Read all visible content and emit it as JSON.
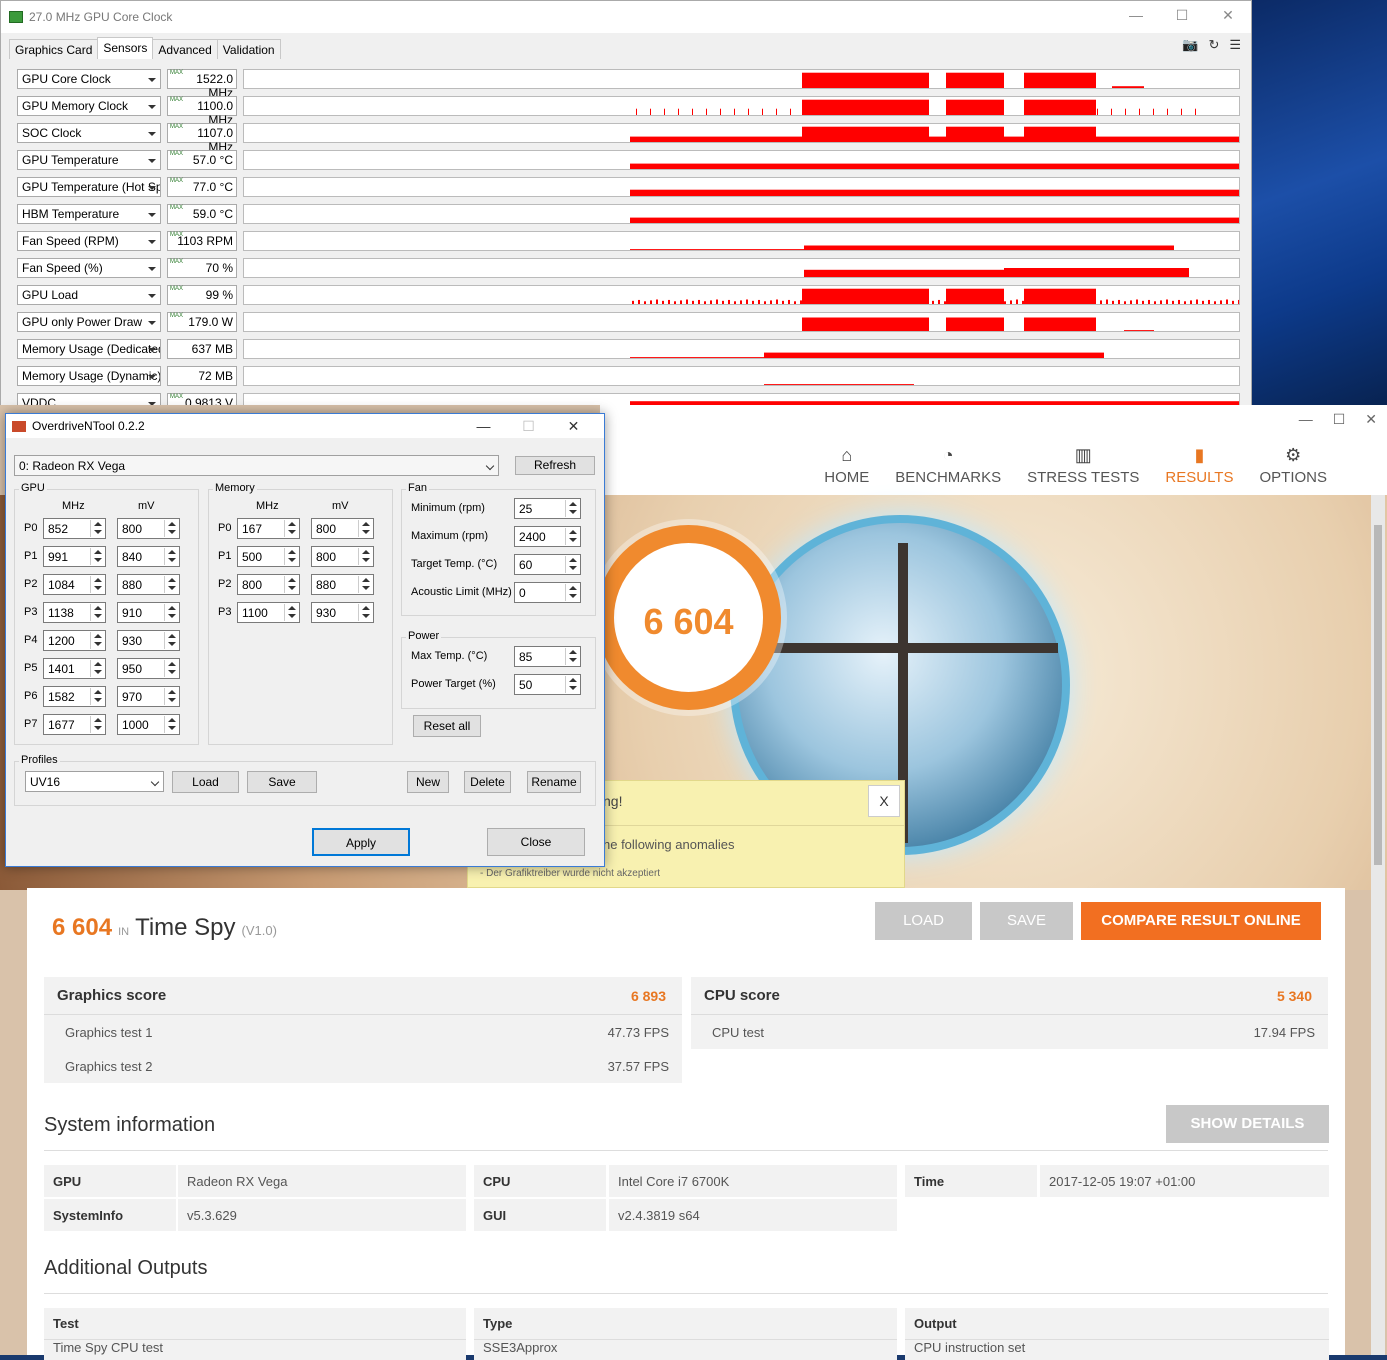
{
  "gpuz": {
    "title": "27.0 MHz GPU Core Clock",
    "tabs": [
      "Graphics Card",
      "Sensors",
      "Advanced",
      "Validation"
    ],
    "max_label": "MAX",
    "sensors": [
      {
        "name": "GPU Core Clock",
        "value": "1522.0 MHz",
        "max": true
      },
      {
        "name": "GPU Memory Clock",
        "value": "1100.0 MHz",
        "max": true
      },
      {
        "name": "SOC Clock",
        "value": "1107.0 MHz",
        "max": true
      },
      {
        "name": "GPU Temperature",
        "value": "57.0 °C",
        "max": true
      },
      {
        "name": "GPU Temperature (Hot Spot)",
        "value": "77.0 °C",
        "max": true
      },
      {
        "name": "HBM Temperature",
        "value": "59.0 °C",
        "max": true
      },
      {
        "name": "Fan Speed (RPM)",
        "value": "1103 RPM",
        "max": true
      },
      {
        "name": "Fan Speed (%)",
        "value": "70 %",
        "max": true
      },
      {
        "name": "GPU Load",
        "value": "99 %",
        "max": true
      },
      {
        "name": "GPU only Power Draw",
        "value": "179.0 W",
        "max": true
      },
      {
        "name": "Memory Usage (Dedicated)",
        "value": "637 MB",
        "max": false
      },
      {
        "name": "Memory Usage (Dynamic)",
        "value": "72 MB",
        "max": false
      },
      {
        "name": "VDDC",
        "value": "0.9813 V",
        "max": true
      }
    ],
    "graph_color": "#ff0000"
  },
  "odnt": {
    "title": "OverdriveNTool 0.2.2",
    "gpu_select": "0: Radeon RX Vega",
    "refresh": "Refresh",
    "gpu_group": "GPU",
    "memory_group": "Memory",
    "fan_group": "Fan",
    "power_group": "Power",
    "col_mhz": "MHz",
    "col_mv": "mV",
    "gpu_states": [
      {
        "p": "P0",
        "mhz": "852",
        "mv": "800"
      },
      {
        "p": "P1",
        "mhz": "991",
        "mv": "840"
      },
      {
        "p": "P2",
        "mhz": "1084",
        "mv": "880"
      },
      {
        "p": "P3",
        "mhz": "1138",
        "mv": "910"
      },
      {
        "p": "P4",
        "mhz": "1200",
        "mv": "930"
      },
      {
        "p": "P5",
        "mhz": "1401",
        "mv": "950"
      },
      {
        "p": "P6",
        "mhz": "1582",
        "mv": "970"
      },
      {
        "p": "P7",
        "mhz": "1677",
        "mv": "1000"
      }
    ],
    "mem_states": [
      {
        "p": "P0",
        "mhz": "167",
        "mv": "800"
      },
      {
        "p": "P1",
        "mhz": "500",
        "mv": "800"
      },
      {
        "p": "P2",
        "mhz": "800",
        "mv": "880"
      },
      {
        "p": "P3",
        "mhz": "1100",
        "mv": "930"
      }
    ],
    "fan": [
      {
        "label": "Minimum (rpm)",
        "value": "25"
      },
      {
        "label": "Maximum (rpm)",
        "value": "2400"
      },
      {
        "label": "Target Temp. (°C)",
        "value": "60"
      },
      {
        "label": "Acoustic Limit (MHz)",
        "value": "0"
      }
    ],
    "power": [
      {
        "label": "Max Temp. (°C)",
        "value": "85"
      },
      {
        "label": "Power Target (%)",
        "value": "50"
      }
    ],
    "reset_all": "Reset all",
    "profiles_label": "Profiles",
    "profile": "UV16",
    "load": "Load",
    "save": "Save",
    "new": "New",
    "delete": "Delete",
    "rename": "Rename",
    "apply": "Apply",
    "close": "Close"
  },
  "tdm": {
    "nav": [
      {
        "label": "HOME",
        "icon": "home-icon",
        "glyph": "⌂",
        "active": false
      },
      {
        "label": "BENCHMARKS",
        "icon": "gauge-icon",
        "glyph": "◔",
        "active": false
      },
      {
        "label": "STRESS TESTS",
        "icon": "bars-icon",
        "glyph": "▥",
        "active": false
      },
      {
        "label": "RESULTS",
        "icon": "chart-icon",
        "glyph": "▮",
        "active": true
      },
      {
        "label": "OPTIONS",
        "icon": "gear-icon",
        "glyph": "⚙",
        "active": false
      }
    ],
    "ring_score": "6 604",
    "warning": {
      "title": "ng!",
      "anomalies": "he following anomalies",
      "detail": "- Der Grafiktreiber wurde nicht akzeptiert",
      "close": "X"
    },
    "score": "6 604",
    "in": "IN",
    "test_name": "Time Spy",
    "version": "(V1.0)",
    "btn_load": "LOAD",
    "btn_save": "SAVE",
    "btn_compare": "COMPARE RESULT ONLINE",
    "graphics": {
      "label": "Graphics score",
      "value": "6 893",
      "tests": [
        {
          "name": "Graphics test 1",
          "value": "47.73 FPS"
        },
        {
          "name": "Graphics test 2",
          "value": "37.57 FPS"
        }
      ]
    },
    "cpu": {
      "label": "CPU score",
      "value": "5 340",
      "tests": [
        {
          "name": "CPU test",
          "value": "17.94 FPS"
        }
      ]
    },
    "sysinfo_title": "System information",
    "show_details": "SHOW DETAILS",
    "sysinfo": [
      {
        "k": "GPU",
        "v": "Radeon RX Vega"
      },
      {
        "k": "CPU",
        "v": "Intel Core i7 6700K"
      },
      {
        "k": "Time",
        "v": "2017-12-05 19:07 +01:00"
      },
      {
        "k": "SystemInfo",
        "v": "v5.3.629"
      },
      {
        "k": "GUI",
        "v": "v2.4.3819 s64"
      }
    ],
    "outputs_title": "Additional Outputs",
    "outputs_headers": [
      "Test",
      "Type",
      "Output"
    ],
    "outputs_row": [
      "Time Spy CPU test",
      "SSE3Approx",
      "CPU instruction set"
    ],
    "accent": "#e87722"
  }
}
